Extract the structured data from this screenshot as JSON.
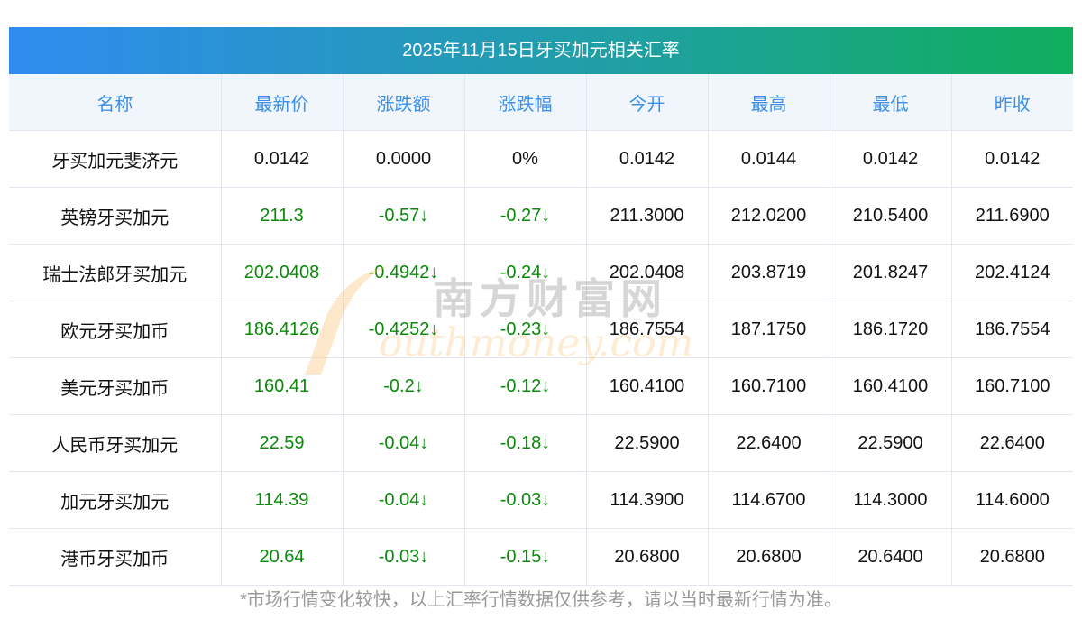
{
  "title": "2025年11月15日牙买加元相关汇率",
  "columns": [
    "名称",
    "最新价",
    "涨跌额",
    "涨跌幅",
    "今开",
    "最高",
    "最低",
    "昨收"
  ],
  "rows": [
    [
      "牙买加元斐济元",
      "0.0142",
      "0.0000",
      "0%",
      "0.0142",
      "0.0144",
      "0.0142",
      "0.0142"
    ],
    [
      "英镑牙买加元",
      "211.3",
      "-0.57↓",
      "-0.27↓",
      "211.3000",
      "212.0200",
      "210.5400",
      "211.6900"
    ],
    [
      "瑞士法郎牙买加元",
      "202.0408",
      "-0.4942↓",
      "-0.24↓",
      "202.0408",
      "203.8719",
      "201.8247",
      "202.4124"
    ],
    [
      "欧元牙买加币",
      "186.4126",
      "-0.4252↓",
      "-0.23↓",
      "186.7554",
      "187.1750",
      "186.1720",
      "186.7554"
    ],
    [
      "美元牙买加币",
      "160.41",
      "-0.2↓",
      "-0.12↓",
      "160.4100",
      "160.7100",
      "160.4100",
      "160.7100"
    ],
    [
      "人民币牙买加元",
      "22.59",
      "-0.04↓",
      "-0.18↓",
      "22.5900",
      "22.6400",
      "22.5900",
      "22.6400"
    ],
    [
      "加元牙买加元",
      "114.39",
      "-0.04↓",
      "-0.03↓",
      "114.3900",
      "114.6700",
      "114.3000",
      "114.6000"
    ],
    [
      "港币牙买加币",
      "20.64",
      "-0.03↓",
      "-0.15↓",
      "20.6800",
      "20.6800",
      "20.6400",
      "20.6800"
    ]
  ],
  "watermark": {
    "cn": "南方财富网",
    "en": "outhmoney.com"
  },
  "footer": "*市场行情变化较快，以上汇率行情数据仅供参考，请以当时最新行情为准。",
  "colors": {
    "header_text": "#3a8ee6",
    "down": "#0a8a0a"
  }
}
